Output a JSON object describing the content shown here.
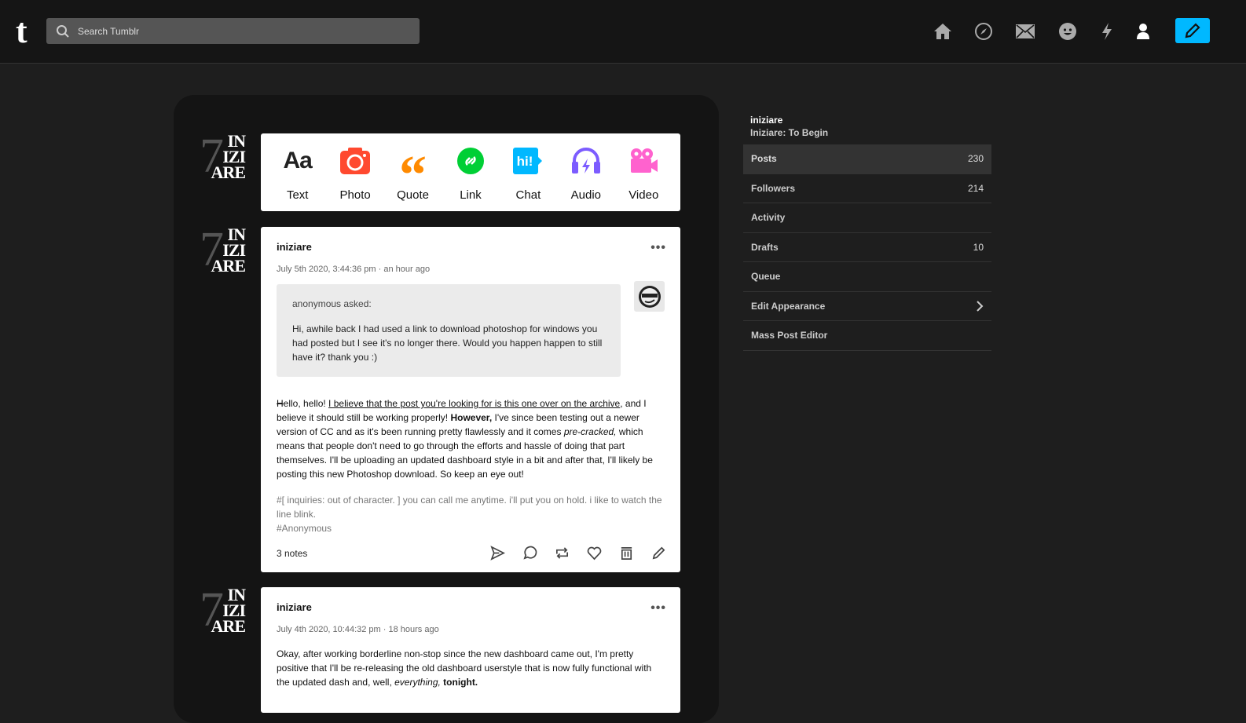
{
  "header": {
    "logo": "t",
    "search_placeholder": "Search Tumblr",
    "accent": "#00b8ff"
  },
  "avatar_text": [
    "IN",
    "IZI",
    "ARE"
  ],
  "post_types": [
    {
      "label": "Text",
      "color": "#000000"
    },
    {
      "label": "Photo",
      "color": "#ff492f"
    },
    {
      "label": "Quote",
      "color": "#ff8a00"
    },
    {
      "label": "Link",
      "color": "#00cf35"
    },
    {
      "label": "Chat",
      "color": "#00b8ff"
    },
    {
      "label": "Audio",
      "color": "#7c5cff"
    },
    {
      "label": "Video",
      "color": "#ff62ce"
    }
  ],
  "posts": [
    {
      "username": "iniziare",
      "date": "July 5th 2020, 3:44:36 pm · an hour ago",
      "ask_from": "anonymous asked:",
      "ask_text": "Hi, awhile back I had used a link to download photoshop for windows you had posted but I see it's no longer there. Would you happen happen to still have it? thank you :)",
      "body_strike": "H",
      "body_a": "ello, hello! ",
      "body_link": "I believe that the post you're looking for is this one over on the archive",
      "body_b": ", and I believe it should still be working properly! ",
      "body_bold": "However,",
      "body_c": " I've since been testing out a newer version of CC and as it's been running pretty flawlessly and it comes ",
      "body_italic": "pre-cracked,",
      "body_d": " which means that people don't need to go through the efforts and hassle of doing that part themselves. I'll be uploading an updated dashboard style in a bit and after that, I'll likely be posting this new Photoshop download. So keep an eye out!",
      "tags": [
        "#[ inquiries: out of character. ] you can call me anytime. i'll put you on hold. i like to watch the line blink.",
        "#Anonymous"
      ],
      "notes": "3 notes"
    },
    {
      "username": "iniziare",
      "date": "July 4th 2020, 10:44:32 pm · 18 hours ago",
      "body_a": "Okay, after working borderline non-stop since the new dashboard came out, I'm pretty positive that I'll be re-releasing the old dashboard userstyle that is now fully functional with the updated dash and, well, ",
      "body_italic": "everything,",
      "body_bold": " tonight."
    }
  ],
  "sidebar": {
    "blog_name": "iniziare",
    "blog_title": "Iniziare: To Begin",
    "items": [
      {
        "label": "Posts",
        "count": "230"
      },
      {
        "label": "Followers",
        "count": "214"
      },
      {
        "label": "Activity"
      },
      {
        "label": "Drafts",
        "count": "10"
      },
      {
        "label": "Queue"
      },
      {
        "label": "Edit Appearance"
      },
      {
        "label": "Mass Post Editor"
      }
    ]
  }
}
